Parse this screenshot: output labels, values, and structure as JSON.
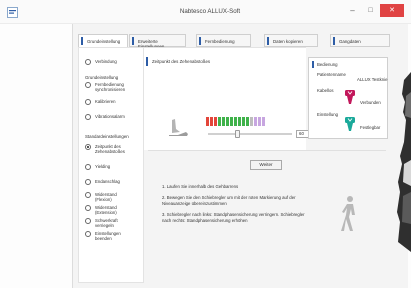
{
  "window": {
    "title": "Nabtesco ALLUX-Soft",
    "minimize_glyph": "–",
    "maximize_glyph": "□",
    "close_glyph": "✕"
  },
  "tabs": [
    {
      "label": "Grundeinstellung",
      "active": true
    },
    {
      "label": "Erweiterte Einstellungen",
      "active": false
    },
    {
      "label": "Fernbedienung",
      "active": false
    },
    {
      "label": "Daten kopieren",
      "active": false
    },
    {
      "label": "Gangdaten",
      "active": false
    }
  ],
  "sidebar": {
    "verbindung": "Verbindung",
    "grundeinstellung_heading": "Grundeinstellung",
    "fernbedienung_sync": "Fernbedienung synchronisieren",
    "kalibrieren": "Kalibrieren",
    "vibrationsalarm": "Vibrationsalarm",
    "standardeinstellungen_heading": "Standardeinstellungen",
    "zeitpunkt": "Zeitpunkt des Zehenabstoßes",
    "yielding": "Yielding",
    "endanschlag": "Endanschlag",
    "widerstand_flexion": "Widerstand (Flexion)",
    "widerstand_extension": "Widerstand (Extension)",
    "schwerkraft": "Schwerkraft verriegeln",
    "einstellungen_beenden": "Einstellungen beenden"
  },
  "panel": {
    "title": "Zeitpunkt des Zehenabstoßes",
    "slider_value": "60",
    "slider_fraction": 0.35,
    "level_colors": [
      "#e3453a",
      "#e3453a",
      "#e3453a",
      "#3fb24a",
      "#3fb24a",
      "#3fb24a",
      "#3fb24a",
      "#3fb24a",
      "#3fb24a",
      "#3fb24a",
      "#3fb24a",
      "#bdbdbd",
      "#c7a6e0",
      "#c7a6e0",
      "#c7a6e0"
    ],
    "weiter_label": "Weiter"
  },
  "info": {
    "bedienung": "Bedienung",
    "patientenname_label": "Patientenname",
    "patientenname_value": "ALLUX Testknie",
    "kabellos_label": "Kabellos",
    "kabellos_status": "Verbunden",
    "einstellung_label": "Einstellung",
    "einstellung_status": "Festlegbar"
  },
  "instructions": [
    "1. Laufen Sie innerhalb des Gehbarrens",
    "2. Bewegen Sie den Schiebregler um mit der roten Markierung auf der Niveauanzeige übereinzustimmen",
    "3. Schiebregler nach links: Standphasensicherung verringern. Schiebregler nach rechts: Standphasensicherung erhöhen"
  ],
  "colors": {
    "accent": "#2e5da6",
    "sensor_magenta": "#c2185b",
    "sensor_teal": "#1aa99a",
    "close_red": "#e04343"
  }
}
